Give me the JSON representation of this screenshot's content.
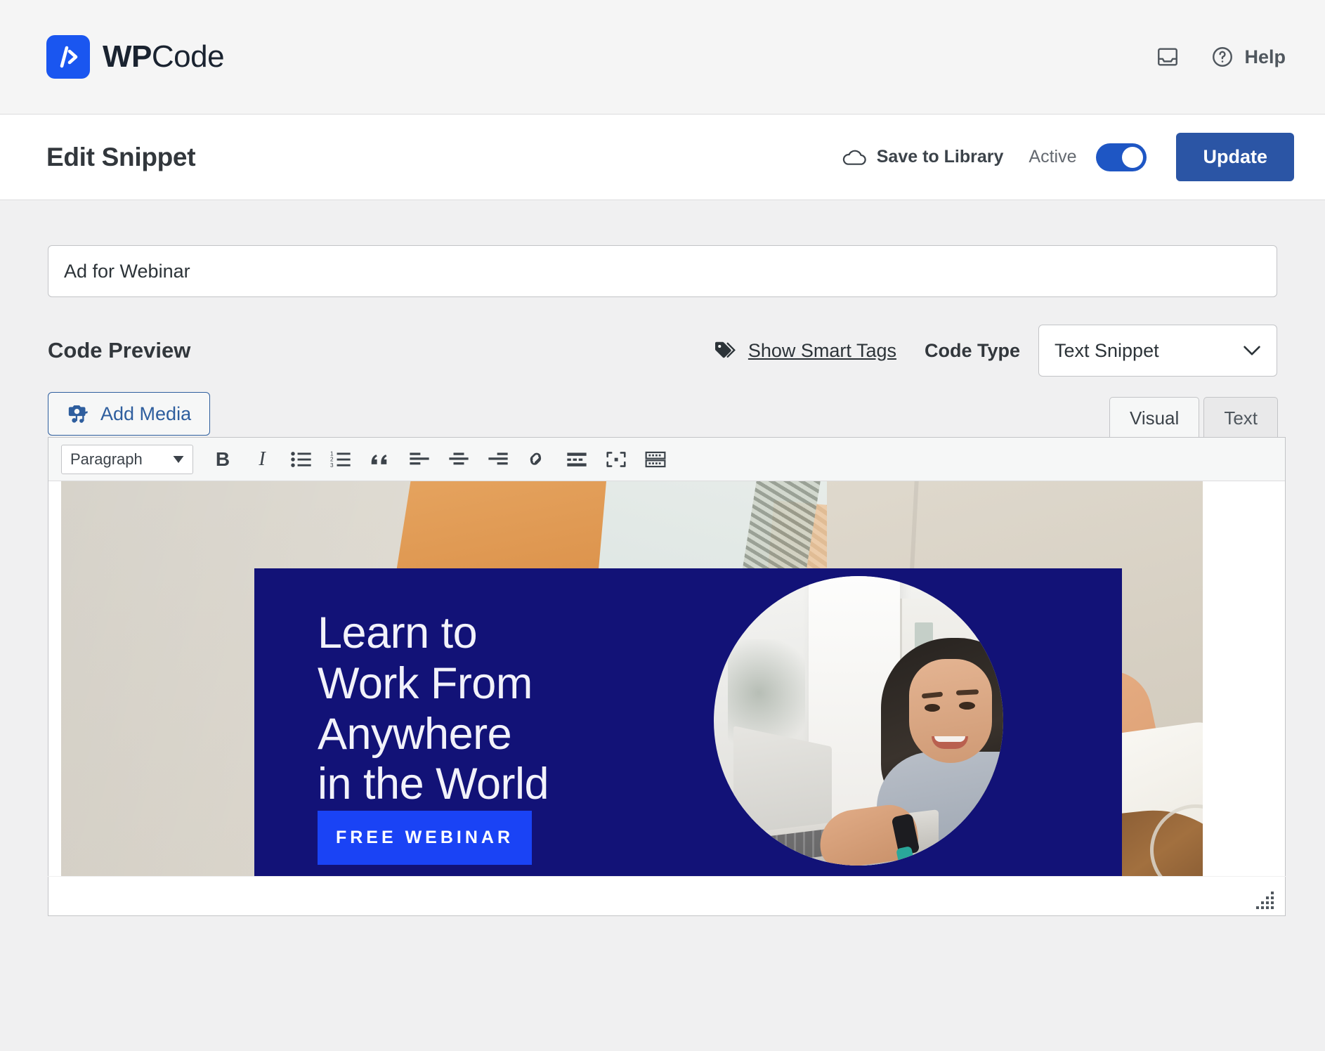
{
  "topbar": {
    "brand_bold": "WP",
    "brand_light": "Code",
    "inbox_icon": "inbox-icon",
    "help_icon": "question-circle-icon",
    "help_label": "Help"
  },
  "subheader": {
    "page_title": "Edit Snippet",
    "cloud_icon": "cloud-icon",
    "save_to_library": "Save to Library",
    "status_label": "Active",
    "toggle_on": true,
    "update_button": "Update"
  },
  "snippet": {
    "title_value": "Ad for Webinar",
    "title_placeholder": "Add title for snippet"
  },
  "code_preview": {
    "section_label": "Code Preview",
    "smart_tags_icon": "tag-icon",
    "smart_tags_link": "Show Smart Tags",
    "code_type_label": "Code Type",
    "code_type_value": "Text Snippet",
    "chevron_icon": "chevron-down-icon"
  },
  "editor": {
    "add_media_label": "Add Media",
    "add_media_icon": "media-camera-note-icon",
    "tabs": [
      {
        "label": "Visual",
        "active": true
      },
      {
        "label": "Text",
        "active": false
      }
    ],
    "toolbar": {
      "format_value": "Paragraph",
      "buttons": [
        {
          "name": "bold-icon",
          "glyph": "B"
        },
        {
          "name": "italic-icon",
          "glyph": "I"
        },
        {
          "name": "bulleted-list-icon",
          "glyph": ""
        },
        {
          "name": "numbered-list-icon",
          "glyph": ""
        },
        {
          "name": "blockquote-icon",
          "glyph": "“"
        },
        {
          "name": "align-left-icon",
          "glyph": ""
        },
        {
          "name": "align-center-icon",
          "glyph": ""
        },
        {
          "name": "align-right-icon",
          "glyph": ""
        },
        {
          "name": "insert-link-icon",
          "glyph": ""
        },
        {
          "name": "read-more-icon",
          "glyph": ""
        },
        {
          "name": "fullscreen-icon",
          "glyph": ""
        },
        {
          "name": "toolbar-toggle-icon",
          "glyph": ""
        }
      ]
    },
    "resize_handle": "resize-handle"
  },
  "ad_creative": {
    "headline": "Learn to\nWork From\nAnywhere\nin the World",
    "cta_label": "FREE WEBINAR",
    "panel_color": "#121277",
    "cta_color": "#1a43f5",
    "photo_alt": "woman-at-laptop-photo"
  },
  "colors": {
    "brand_blue": "#1a56f0",
    "update_blue": "#2b55a5",
    "toggle_blue": "#1e56c4",
    "link_blue": "#2e5e9e",
    "page_bg": "#f0f0f1",
    "header_bg": "#f5f5f5"
  }
}
